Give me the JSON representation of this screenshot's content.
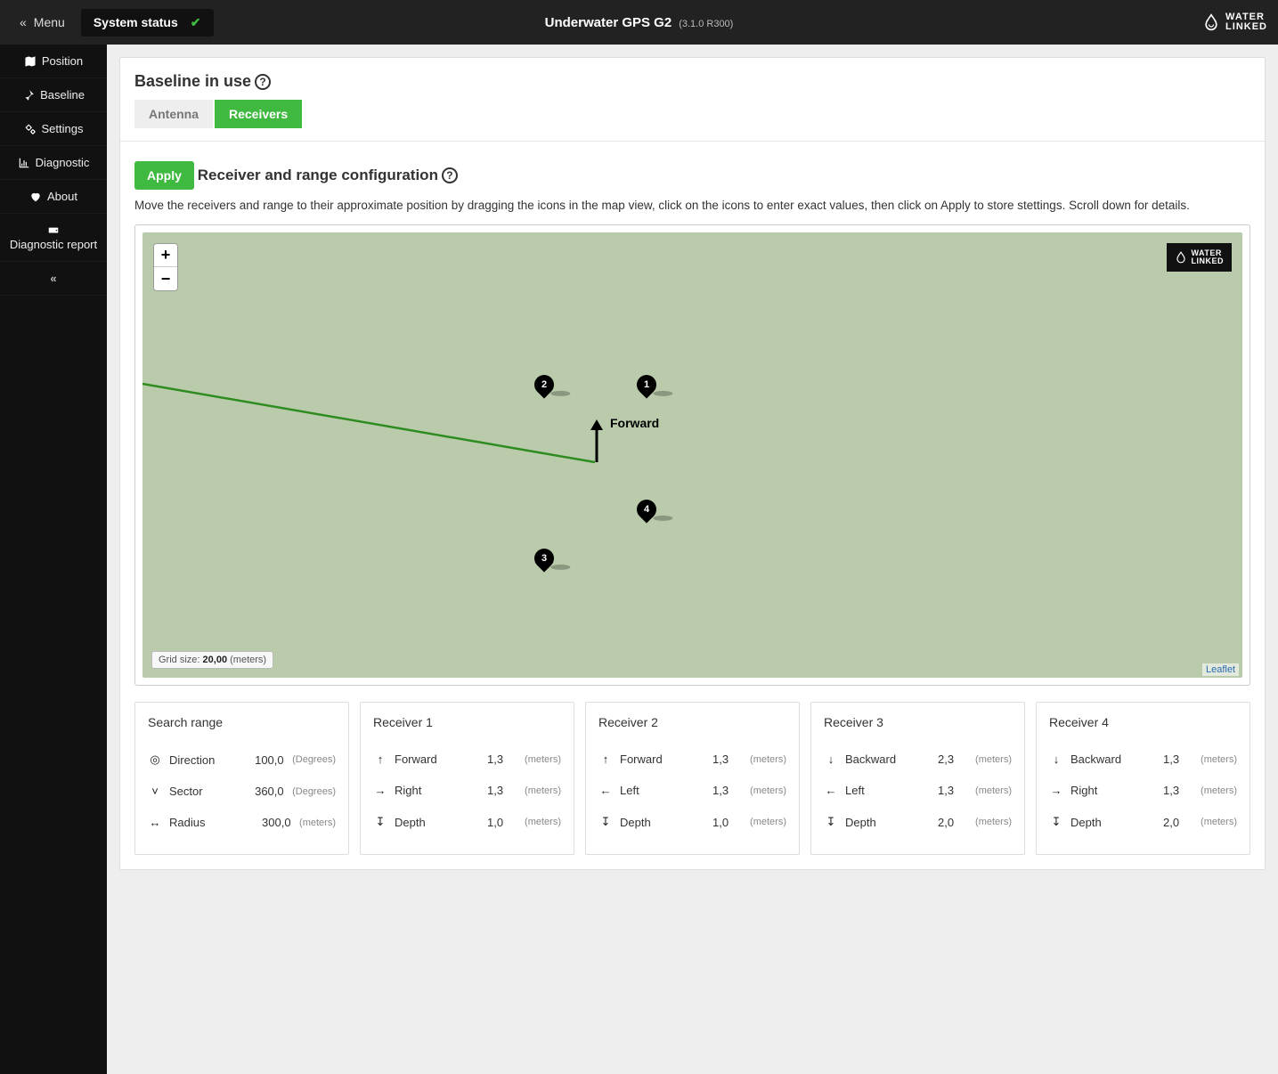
{
  "topbar": {
    "menu_label": "Menu",
    "status_label": "System status",
    "app_title": "Underwater GPS G2",
    "version": "(3.1.0 R300)",
    "logo_text": "WATER\nLINKED"
  },
  "sidebar": {
    "items": [
      {
        "icon": "map-icon",
        "label": "Position"
      },
      {
        "icon": "pin-icon",
        "label": "Baseline"
      },
      {
        "icon": "cogs-icon",
        "label": "Settings"
      },
      {
        "icon": "chart-icon",
        "label": "Diagnostic"
      },
      {
        "icon": "heart-icon",
        "label": "About"
      },
      {
        "icon": "drive-icon",
        "label": "Diagnostic report"
      }
    ]
  },
  "panel": {
    "baseline_heading": "Baseline in use",
    "tab_antenna": "Antenna",
    "tab_receivers": "Receivers",
    "apply_label": "Apply",
    "config_heading": "Receiver and range configuration",
    "instructions": "Move the receivers and range to their approximate position by dragging the icons in the map view, click on the icons to enter exact values, then click on Apply to store stettings. Scroll down for details."
  },
  "map": {
    "forward_label": "Forward",
    "gridsize_label": "Grid size:",
    "gridsize_value": "20,00",
    "gridsize_unit": "(meters)",
    "attribution": "Leaflet",
    "logo_text": "WATER\nLINKED"
  },
  "cards": {
    "search": {
      "title": "Search range",
      "rows": [
        {
          "icon": "compass",
          "label": "Direction",
          "value": "100,0",
          "unit": "(Degrees)"
        },
        {
          "icon": "chevdown",
          "label": "Sector",
          "value": "360,0",
          "unit": "(Degrees)"
        },
        {
          "icon": "lr",
          "label": "Radius",
          "value": "300,0",
          "unit": "(meters)"
        }
      ]
    },
    "r1": {
      "title": "Receiver 1",
      "rows": [
        {
          "icon": "up",
          "label": "Forward",
          "value": "1,3",
          "unit": "(meters)"
        },
        {
          "icon": "right",
          "label": "Right",
          "value": "1,3",
          "unit": "(meters)"
        },
        {
          "icon": "depth",
          "label": "Depth",
          "value": "1,0",
          "unit": "(meters)"
        }
      ]
    },
    "r2": {
      "title": "Receiver 2",
      "rows": [
        {
          "icon": "up",
          "label": "Forward",
          "value": "1,3",
          "unit": "(meters)"
        },
        {
          "icon": "left",
          "label": "Left",
          "value": "1,3",
          "unit": "(meters)"
        },
        {
          "icon": "depth",
          "label": "Depth",
          "value": "1,0",
          "unit": "(meters)"
        }
      ]
    },
    "r3": {
      "title": "Receiver 3",
      "rows": [
        {
          "icon": "down",
          "label": "Backward",
          "value": "2,3",
          "unit": "(meters)"
        },
        {
          "icon": "left",
          "label": "Left",
          "value": "1,3",
          "unit": "(meters)"
        },
        {
          "icon": "depth",
          "label": "Depth",
          "value": "2,0",
          "unit": "(meters)"
        }
      ]
    },
    "r4": {
      "title": "Receiver 4",
      "rows": [
        {
          "icon": "down",
          "label": "Backward",
          "value": "1,3",
          "unit": "(meters)"
        },
        {
          "icon": "right",
          "label": "Right",
          "value": "1,3",
          "unit": "(meters)"
        },
        {
          "icon": "depth",
          "label": "Depth",
          "value": "2,0",
          "unit": "(meters)"
        }
      ]
    }
  }
}
